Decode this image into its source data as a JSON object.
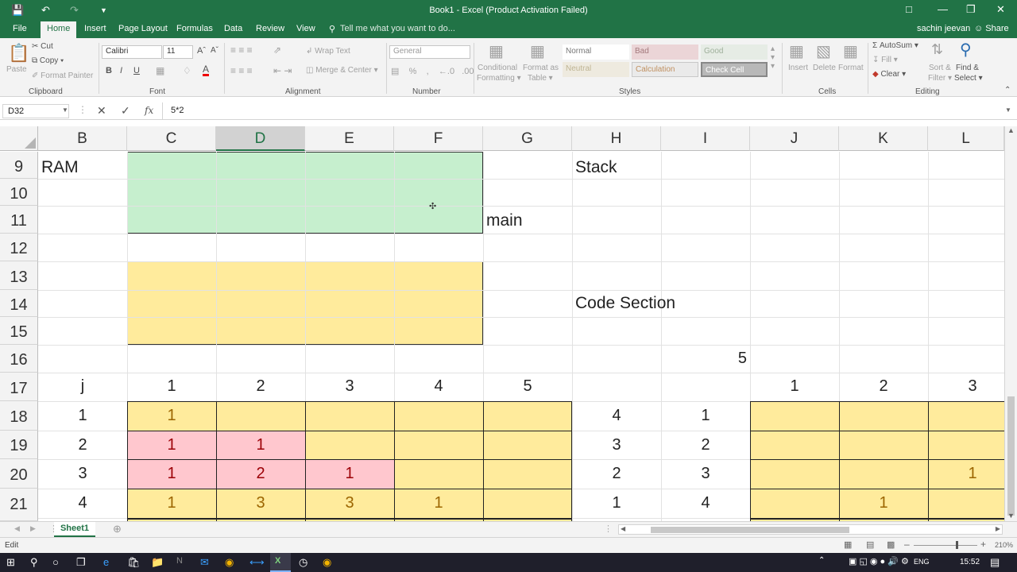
{
  "window": {
    "title": "Book1 - Excel (Product Activation Failed)"
  },
  "tabs": [
    "File",
    "Home",
    "Insert",
    "Page Layout",
    "Formulas",
    "Data",
    "Review",
    "View"
  ],
  "tell_me": "Tell me what you want to do...",
  "user": "sachin jeevan",
  "share": "Share",
  "clipboard": {
    "paste": "Paste",
    "cut": "Cut",
    "copy": "Copy",
    "format_painter": "Format Painter",
    "label": "Clipboard"
  },
  "font": {
    "name": "Calibri",
    "size": "11",
    "label": "Font"
  },
  "alignment": {
    "wrap": "Wrap Text",
    "merge": "Merge & Center",
    "label": "Alignment"
  },
  "number": {
    "format": "General",
    "label": "Number"
  },
  "styles": {
    "conditional": "Conditional",
    "formatting": "Formatting",
    "format_as": "Format as",
    "table": "Table",
    "normal": "Normal",
    "bad": "Bad",
    "good": "Good",
    "neutral": "Neutral",
    "calculation": "Calculation",
    "check_cell": "Check Cell",
    "label": "Styles"
  },
  "cells_group": {
    "insert": "Insert",
    "delete": "Delete",
    "format": "Format",
    "label": "Cells"
  },
  "editing": {
    "autosum": "AutoSum",
    "fill": "Fill",
    "clear": "Clear",
    "sort": "Sort &",
    "filter": "Filter",
    "find": "Find &",
    "select": "Select",
    "label": "Editing"
  },
  "formula_bar": {
    "name_box": "D32",
    "formula": "5*2"
  },
  "columns": [
    "B",
    "C",
    "D",
    "E",
    "F",
    "G",
    "H",
    "I",
    "J",
    "K",
    "L"
  ],
  "rows": [
    "9",
    "10",
    "11",
    "12",
    "13",
    "14",
    "15",
    "16",
    "17",
    "18",
    "19",
    "20",
    "21"
  ],
  "cells": {
    "b9": "RAM",
    "h9": "Stack",
    "g11": "main",
    "h14": "Code Section",
    "i16": "5",
    "b17": "j",
    "c17": "1",
    "d17": "2",
    "e17": "3",
    "f17": "4",
    "g17": "5",
    "j17": "1",
    "k17": "2",
    "l17": "3",
    "b18": "1",
    "c18": "1",
    "h18": "4",
    "i18": "1",
    "b19": "2",
    "c19": "1",
    "d19": "1",
    "h19": "3",
    "i19": "2",
    "b20": "3",
    "c20": "1",
    "d20": "2",
    "e20": "1",
    "h20": "2",
    "i20": "3",
    "l20": "1",
    "b21": "4",
    "c21": "1",
    "d21": "3",
    "e21": "3",
    "f21": "1",
    "h21": "1",
    "i21": "4",
    "k21": "1"
  },
  "sheet": {
    "name": "Sheet1"
  },
  "status": {
    "mode": "Edit",
    "zoom": "210%"
  },
  "taskbar": {
    "lang": "ENG",
    "time": "15:52"
  },
  "colors": {
    "excel_green": "#217346",
    "green_fill": "#c6efce",
    "yellow_fill": "#ffeb9c",
    "pink_fill": "#ffc7ce",
    "yellow_text": "#9c6500",
    "red_text": "#9c0006"
  }
}
